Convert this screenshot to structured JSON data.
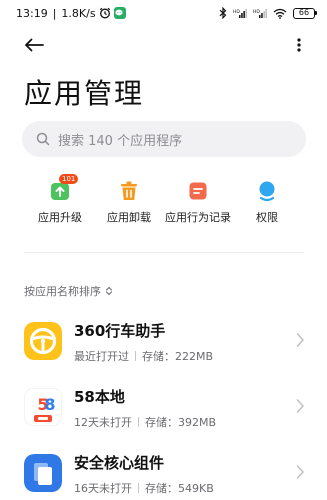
{
  "status_bar": {
    "time": "13:19",
    "speed": "1.8K/s",
    "battery": "66"
  },
  "page": {
    "title": "应用管理"
  },
  "search": {
    "placeholder": "搜索 140 个应用程序"
  },
  "actions": [
    {
      "label": "应用升级",
      "icon": "upgrade-icon",
      "badge": "101",
      "color": "#4cc35d"
    },
    {
      "label": "应用卸载",
      "icon": "trash-icon",
      "color": "#f39a1f"
    },
    {
      "label": "应用行为记录",
      "icon": "behavior-record-icon",
      "color": "#f26a4b"
    },
    {
      "label": "权限",
      "icon": "permission-icon",
      "color": "#2ea6f0"
    }
  ],
  "sort": {
    "label": "按应用名称排序"
  },
  "apps": [
    {
      "name": "360行车助手",
      "last_opened": "最近打开过",
      "storage": "存储：222MB",
      "icon": "360-car-assistant-icon"
    },
    {
      "name": "58本地",
      "last_opened": "12天未打开",
      "storage": "存储：392MB",
      "icon": "58-local-icon"
    },
    {
      "name": "安全核心组件",
      "last_opened": "16天未打开",
      "storage": "存储：549KB",
      "icon": "security-core-icon"
    }
  ],
  "colors": {
    "search_bg": "#f1f1f3",
    "badge": "#f24b1a",
    "text_secondary": "#6b6b70"
  }
}
